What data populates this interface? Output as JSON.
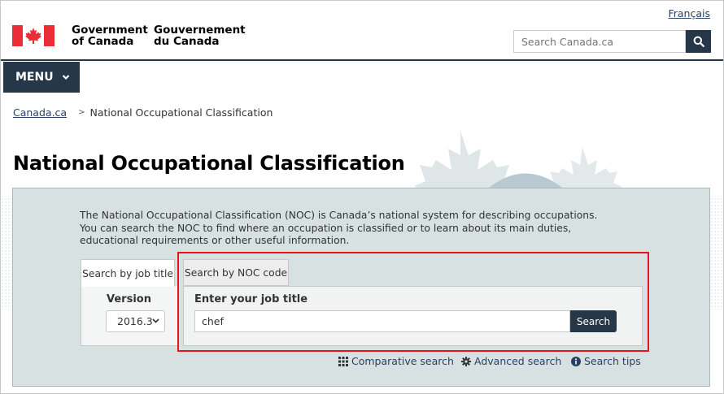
{
  "header": {
    "language_link": "Français",
    "signature_en_line1": "Government",
    "signature_en_line2": "of Canada",
    "signature_fr_line1": "Gouvernement",
    "signature_fr_line2": "du Canada",
    "search_placeholder": "Search Canada.ca",
    "search_icon": "search-icon"
  },
  "menu": {
    "label": "MENU",
    "icon": "chevron-down-icon"
  },
  "breadcrumb": {
    "home": "Canada.ca",
    "separator": ">",
    "current": "National Occupational Classification"
  },
  "page": {
    "title": "National Occupational Classification",
    "intro_line1": "The National Occupational Classification (NOC) is Canada’s national system for describing occupations.",
    "intro_line2": "You can search the NOC to find where an occupation is classified or to learn about its main duties, educational requirements or other useful information."
  },
  "tabs": [
    {
      "label": "Search by job title",
      "active": true
    },
    {
      "label": "Search by NOC code",
      "active": false
    }
  ],
  "form": {
    "version_label": "Version",
    "version_value": "2016.3",
    "job_title_label": "Enter your job title",
    "job_title_value": "chef",
    "search_button": "Search"
  },
  "links": [
    {
      "label": "Comparative search",
      "icon": "grid-icon"
    },
    {
      "label": "Advanced search",
      "icon": "gear-icon"
    },
    {
      "label": "Search tips",
      "icon": "info-icon"
    }
  ],
  "colors": {
    "brand_navy": "#26374a",
    "link": "#284162",
    "flag_red": "#eb2d37",
    "panel_bg": "#d7e1e1",
    "highlight_red": "#e4131d"
  }
}
